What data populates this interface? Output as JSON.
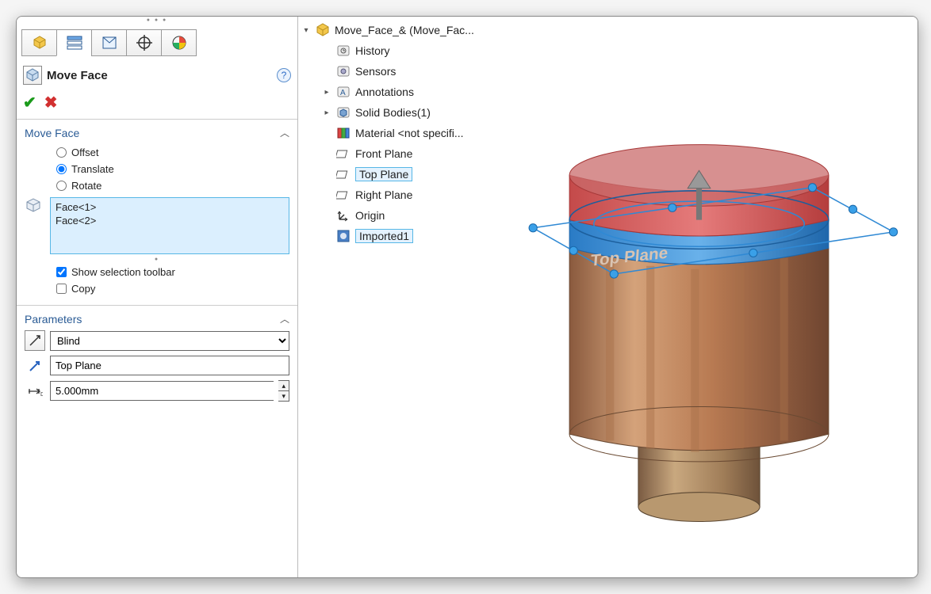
{
  "feature": {
    "title": "Move Face"
  },
  "moveFace": {
    "sectionTitle": "Move Face",
    "options": {
      "offset": "Offset",
      "translate": "Translate",
      "rotate": "Rotate"
    },
    "selected": "translate",
    "faces": [
      "Face<1>",
      "Face<2>"
    ],
    "showSelectionToolbar": {
      "label": "Show selection toolbar",
      "checked": true
    },
    "copy": {
      "label": "Copy",
      "checked": false
    }
  },
  "parameters": {
    "sectionTitle": "Parameters",
    "endCondition": "Blind",
    "direction": "Top Plane",
    "distance": "5.000mm"
  },
  "tree": {
    "root": "Move_Face_& (Move_Fac...",
    "items": [
      {
        "label": "History",
        "icon": "history"
      },
      {
        "label": "Sensors",
        "icon": "sensors"
      },
      {
        "label": "Annotations",
        "icon": "annotations",
        "expandable": true
      },
      {
        "label": "Solid Bodies(1)",
        "icon": "solidbodies",
        "expandable": true
      },
      {
        "label": "Material <not specifi...",
        "icon": "material"
      },
      {
        "label": "Front Plane",
        "icon": "plane"
      },
      {
        "label": "Top Plane",
        "icon": "plane",
        "selected": true
      },
      {
        "label": "Right Plane",
        "icon": "plane"
      },
      {
        "label": "Origin",
        "icon": "origin"
      },
      {
        "label": "Imported1",
        "icon": "imported",
        "selected": true
      }
    ]
  },
  "viewport": {
    "planeLabel": "Top Plane"
  }
}
